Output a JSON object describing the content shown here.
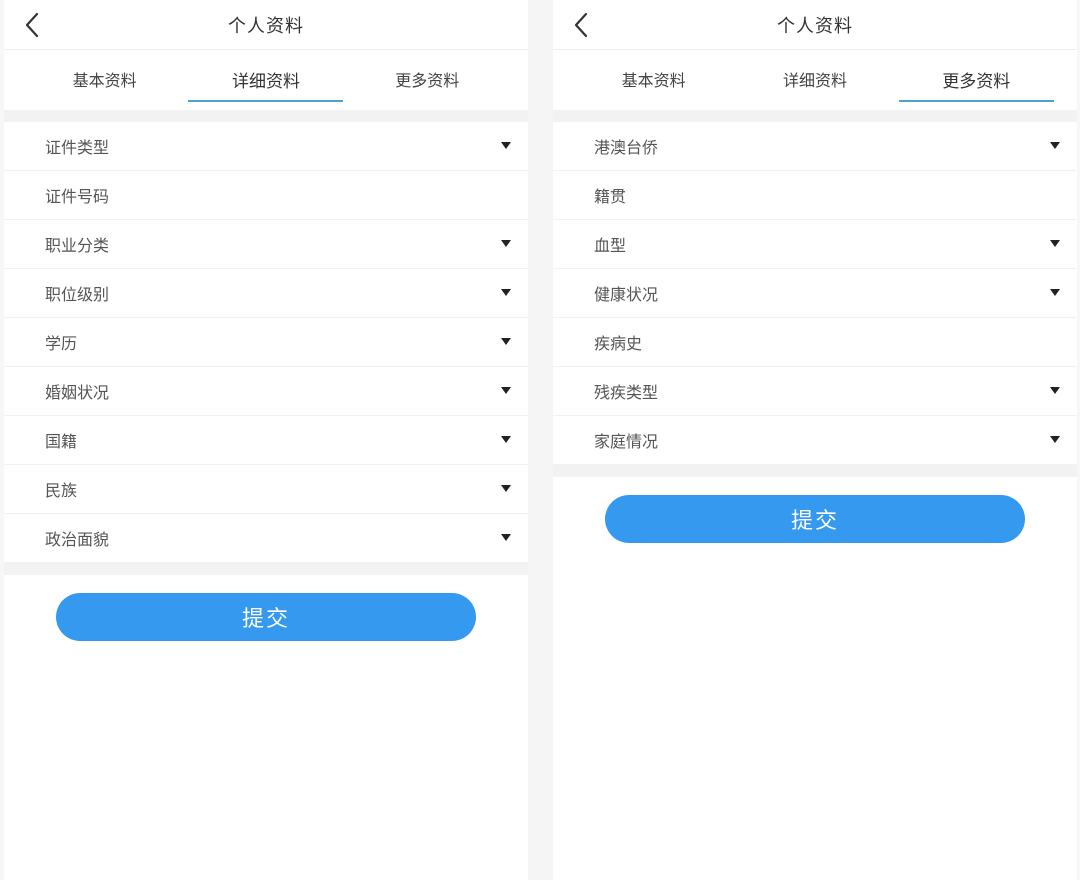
{
  "left": {
    "header": {
      "title": "个人资料",
      "back_icon": "chevron-left-icon"
    },
    "tabs": [
      {
        "label": "基本资料",
        "active": false
      },
      {
        "label": "详细资料",
        "active": true
      },
      {
        "label": "更多资料",
        "active": false
      }
    ],
    "fields": [
      {
        "label": "证件类型",
        "dropdown": true
      },
      {
        "label": "证件号码",
        "dropdown": false
      },
      {
        "label": "职业分类",
        "dropdown": true
      },
      {
        "label": "职位级别",
        "dropdown": true
      },
      {
        "label": "学历",
        "dropdown": true
      },
      {
        "label": "婚姻状况",
        "dropdown": true
      },
      {
        "label": "国籍",
        "dropdown": true
      },
      {
        "label": "民族",
        "dropdown": true
      },
      {
        "label": "政治面貌",
        "dropdown": true
      }
    ],
    "submit_label": "提交"
  },
  "right": {
    "header": {
      "title": "个人资料",
      "back_icon": "chevron-left-icon"
    },
    "tabs": [
      {
        "label": "基本资料",
        "active": false
      },
      {
        "label": "详细资料",
        "active": false
      },
      {
        "label": "更多资料",
        "active": true
      }
    ],
    "fields": [
      {
        "label": "港澳台侨",
        "dropdown": true
      },
      {
        "label": "籍贯",
        "dropdown": false
      },
      {
        "label": "血型",
        "dropdown": true
      },
      {
        "label": "健康状况",
        "dropdown": true
      },
      {
        "label": "疾病史",
        "dropdown": false
      },
      {
        "label": "残疾类型",
        "dropdown": true
      },
      {
        "label": "家庭情况",
        "dropdown": true
      }
    ],
    "submit_label": "提交"
  },
  "colors": {
    "accent": "#3499ef",
    "tab_underline": "#4aa3c9",
    "separator": "#f2f2f2"
  }
}
